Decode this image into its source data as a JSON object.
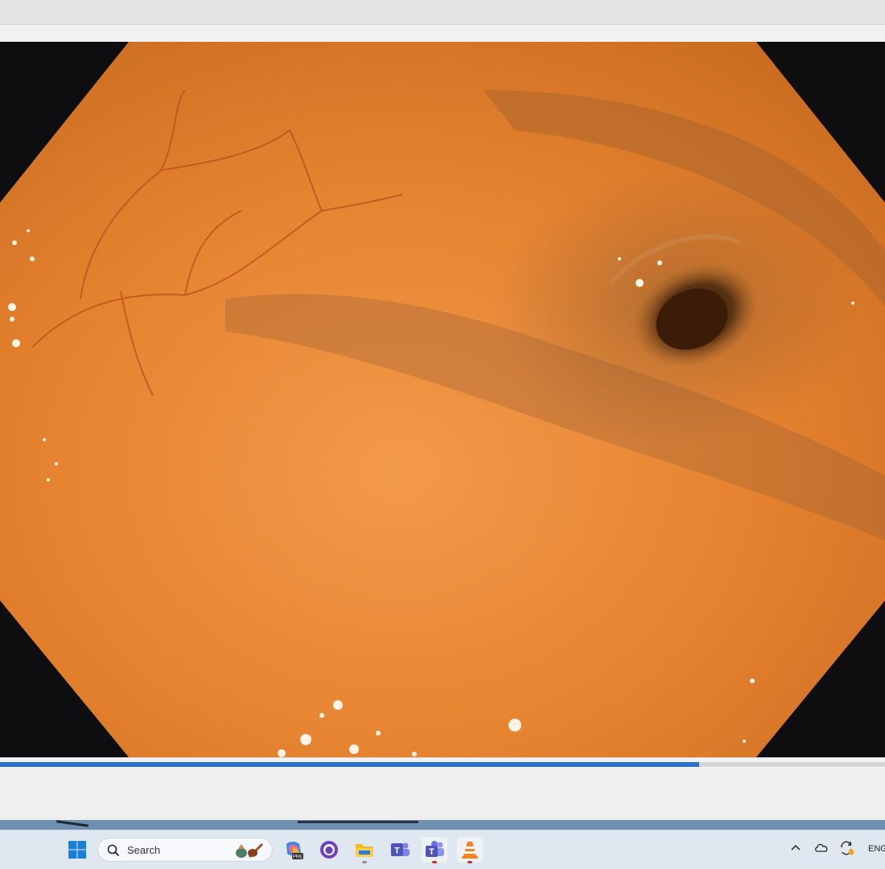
{
  "window": {
    "title": ""
  },
  "video": {
    "frame_shape": "octagon",
    "content": "endoscopy-colon-lumen",
    "tissue_color": "#e2782c",
    "border_color": "#0e0e10"
  },
  "playback": {
    "progress_fraction": 0.79,
    "progress_color": "#2b72c4"
  },
  "taskbar": {
    "search_placeholder": "Search",
    "pinned": [
      {
        "name": "windows-start-icon"
      },
      {
        "name": "copilot-pre-icon",
        "badge": "PRE"
      },
      {
        "name": "github-desktop-icon"
      },
      {
        "name": "file-explorer-icon"
      },
      {
        "name": "teams-classic-icon"
      },
      {
        "name": "teams-icon"
      },
      {
        "name": "vlc-icon"
      }
    ],
    "tray": {
      "language": "ENG"
    }
  }
}
